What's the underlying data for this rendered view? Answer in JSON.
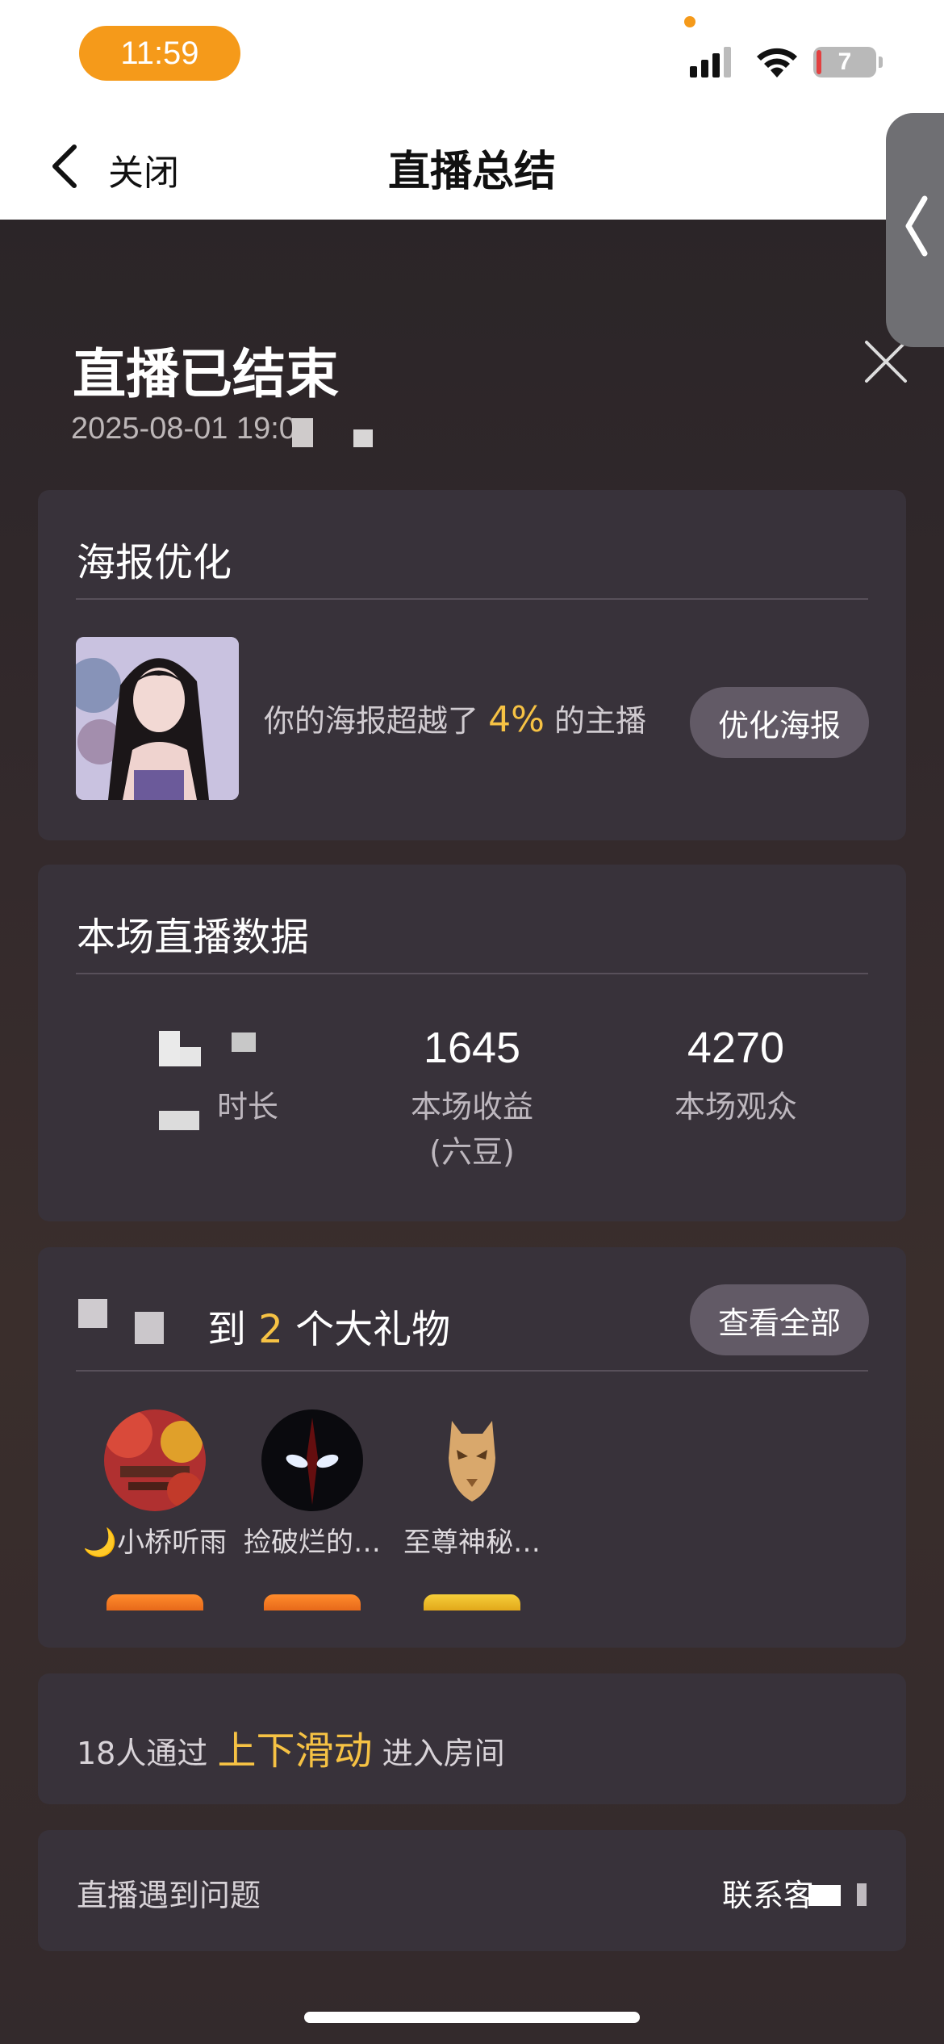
{
  "status_bar": {
    "time": "11:59",
    "battery": "7"
  },
  "nav": {
    "close_label": "关闭",
    "title": "直播总结"
  },
  "summary": {
    "heading": "直播已结束",
    "date": "2025-08-01 19:0"
  },
  "poster": {
    "title": "海报优化",
    "text_prefix": "你的海报超越了",
    "percent": "4%",
    "text_suffix": "的主播",
    "button": "优化海报"
  },
  "live_data": {
    "title": "本场直播数据",
    "stats": [
      {
        "value": "",
        "label": "时长"
      },
      {
        "value": "1645",
        "label": "本场收益",
        "sub": "(六豆)"
      },
      {
        "value": "4270",
        "label": "本场观众"
      }
    ]
  },
  "gifts": {
    "title_suffix": "到",
    "count": "2",
    "title_tail": "个大礼物",
    "view_all": "查看全部",
    "users": [
      {
        "name": "🌙小桥听雨"
      },
      {
        "name": "捡破烂的…"
      },
      {
        "name": "至尊神秘…"
      }
    ]
  },
  "swipe": {
    "prefix": "18人通过",
    "highlight": "上下滑动",
    "suffix": "进入房间"
  },
  "problem": {
    "label": "直播遇到问题",
    "contact": "联系客"
  },
  "colors": {
    "accent": "#f6c244",
    "status_orange": "#f59a1a",
    "card": "#38323a"
  }
}
